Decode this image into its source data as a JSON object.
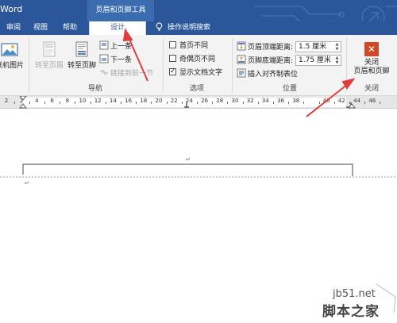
{
  "app": {
    "name": "Word",
    "context_header": "页眉和页脚工具"
  },
  "tabs": [
    {
      "label": "审阅"
    },
    {
      "label": "视图"
    },
    {
      "label": "帮助"
    },
    {
      "label": "设计",
      "active": true
    }
  ],
  "tell_me": {
    "label": "操作说明搜索",
    "icon": "lightbulb-icon"
  },
  "ribbon": {
    "insert": {
      "online_pictures_label": "联机图片"
    },
    "navigation": {
      "group_label": "导航",
      "goto_header_label": "转至页眉",
      "goto_footer_label": "转至页脚",
      "previous_label": "上一条",
      "next_label": "下一条",
      "link_previous_label": "链接到前一节"
    },
    "options": {
      "group_label": "选项",
      "different_first_page": {
        "label": "首页不同",
        "checked": false
      },
      "different_odd_even": {
        "label": "奇偶页不同",
        "checked": false
      },
      "show_document_text": {
        "label": "显示文档文字",
        "checked": true
      }
    },
    "position": {
      "group_label": "位置",
      "header_from_top_label": "页眉顶端距离:",
      "header_from_top_value": "1.5 厘米",
      "footer_from_bottom_label": "页脚底端距离:",
      "footer_from_bottom_value": "1.75 厘米",
      "insert_alignment_tab_label": "插入对齐制表位"
    },
    "close": {
      "group_label": "关闭",
      "close_button_line1": "关闭",
      "close_button_line2": "页眉和页脚"
    }
  },
  "ruler": {
    "labels": [
      "2",
      "2",
      "4",
      "6",
      "8",
      "10",
      "12",
      "14",
      "16",
      "18",
      "20",
      "22",
      "24",
      "26",
      "28",
      "30",
      "32",
      "34",
      "36",
      "38",
      "",
      "40",
      "42",
      "44",
      "46"
    ]
  },
  "document": {
    "paragraph_mark": "↵"
  },
  "watermark": {
    "url": "jb51.net",
    "site_name": "脚本之家"
  },
  "colors": {
    "brand_blue": "#2b579a",
    "annotation_red": "#e03c3c",
    "close_red": "#d24726"
  }
}
